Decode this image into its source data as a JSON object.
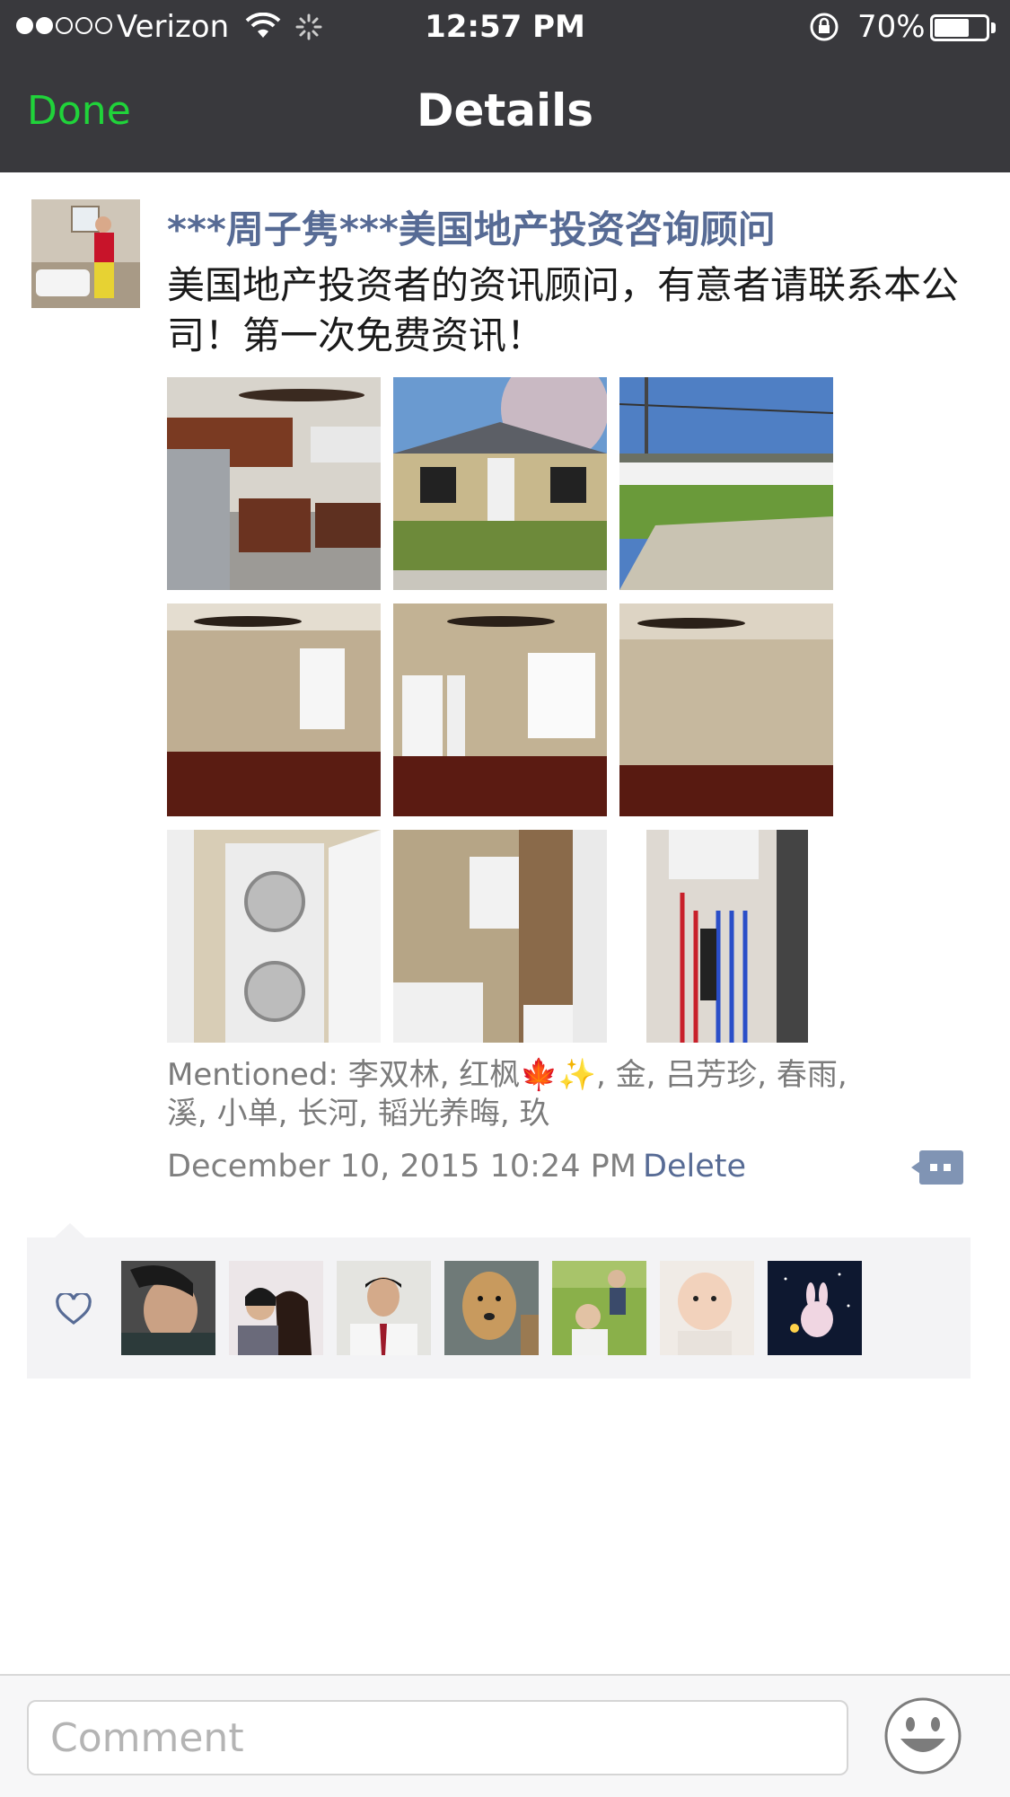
{
  "status_bar": {
    "carrier": "Verizon",
    "time": "12:57 PM",
    "battery_percent": "70%",
    "battery_level": 0.7,
    "signal_bars_filled": 2,
    "signal_bars_total": 5
  },
  "nav": {
    "done_label": "Done",
    "title": "Details"
  },
  "post": {
    "author": "***周子隽***美国地产投资咨询顾问",
    "text": "美国地产投资者的资讯顾问，有意者请联系本公司！第一次免费资讯！",
    "photos": [
      {
        "icon": "kitchen-photo"
      },
      {
        "icon": "house-exterior-photo"
      },
      {
        "icon": "backyard-photo"
      },
      {
        "icon": "bedroom-photo"
      },
      {
        "icon": "living-room-photo"
      },
      {
        "icon": "empty-room-photo"
      },
      {
        "icon": "laundry-photo"
      },
      {
        "icon": "bathroom-photo"
      },
      {
        "icon": "water-heater-photo"
      }
    ],
    "mentioned": "Mentioned: 李双林, 红枫🍁✨, 金, 吕芳珍, 春雨, 溪, 小单, 长河, 韬光养晦, 玖",
    "timestamp": "December 10, 2015 10:24 PM",
    "delete_label": "Delete"
  },
  "likes": {
    "icon": "heart-icon",
    "users": [
      {
        "icon": "liker-avatar-1"
      },
      {
        "icon": "liker-avatar-2"
      },
      {
        "icon": "liker-avatar-3"
      },
      {
        "icon": "liker-avatar-4"
      },
      {
        "icon": "liker-avatar-5"
      },
      {
        "icon": "liker-avatar-6"
      },
      {
        "icon": "liker-avatar-7"
      }
    ]
  },
  "comment_bar": {
    "placeholder": "Comment"
  },
  "colors": {
    "bar_background": "#39393d",
    "done_green": "#20d33a",
    "link_blue": "#576b95",
    "likes_background": "#f3f3f5"
  }
}
